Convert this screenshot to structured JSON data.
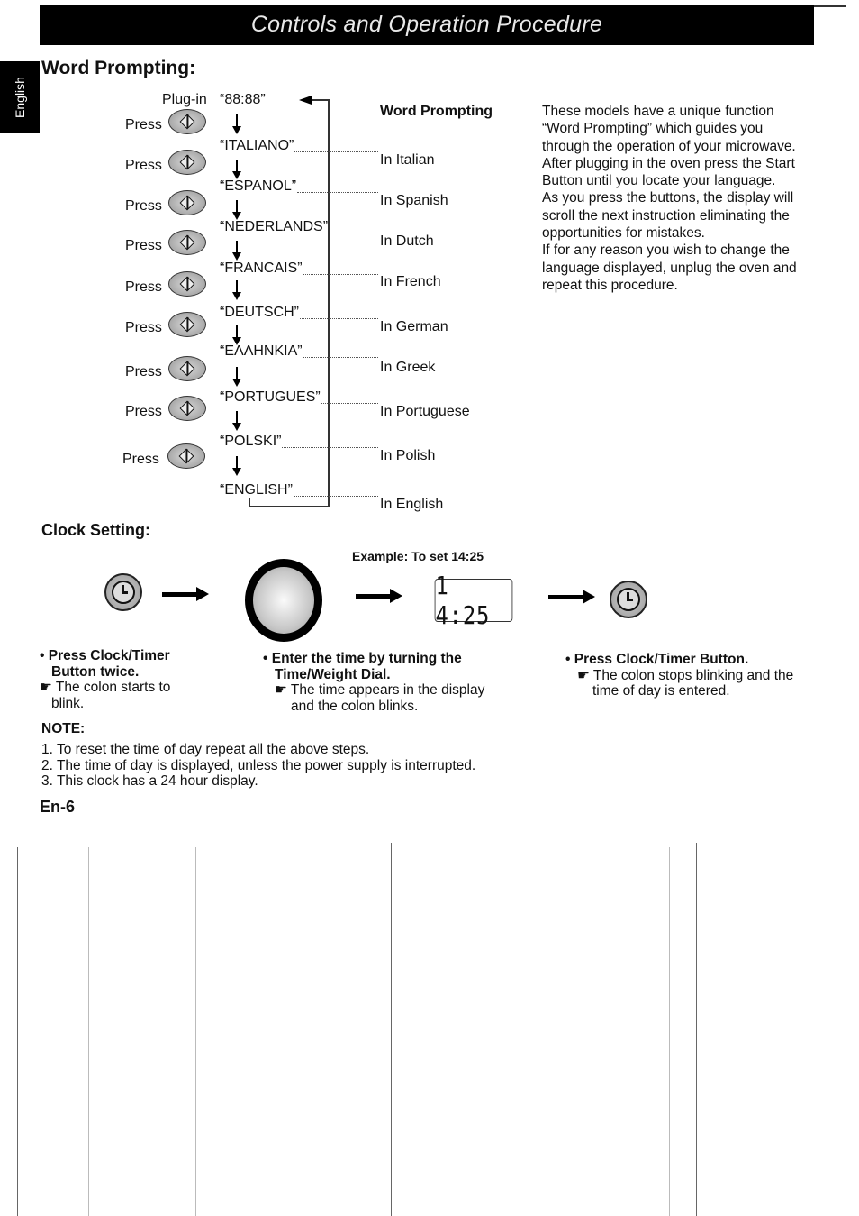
{
  "header": {
    "title": "Controls and Operation Procedure"
  },
  "side_tab": {
    "label": "English"
  },
  "word_prompting": {
    "heading": "Word Prompting:",
    "plug_in_label": "Plug-in",
    "initial_display": "“88:88”",
    "column_heading": "Word Prompting",
    "press_label": "Press",
    "button_icon": "start-button-diamond-icon",
    "steps": [
      {
        "display": "“ITALIANO”",
        "meaning": "In Italian"
      },
      {
        "display": "“ESPANOL”",
        "meaning": "In Spanish"
      },
      {
        "display": "“NEDERLANDS”",
        "meaning": "In Dutch"
      },
      {
        "display": "“FRANCAIS”",
        "meaning": "In French"
      },
      {
        "display": "“DEUTSCH”",
        "meaning": "In German"
      },
      {
        "display": "“ΕΛΛΗΝΚΙΑ”",
        "meaning": "In Greek"
      },
      {
        "display": "“PORTUGUES”",
        "meaning": "In Portuguese"
      },
      {
        "display": "“POLSKI”",
        "meaning": "In Polish"
      },
      {
        "display": "“ENGLISH”",
        "meaning": "In English"
      }
    ],
    "description": [
      "These models have a unique function",
      "“Word Prompting” which guides you",
      "through the operation of your microwave.",
      "After plugging in the oven press the Start",
      "Button until you locate your language.",
      "As you press the buttons, the display will",
      "scroll the next instruction eliminating the",
      "opportunities for mistakes.",
      "If for any reason you wish to change the",
      "language displayed, unplug the oven and",
      "repeat this procedure."
    ]
  },
  "clock_setting": {
    "heading": "Clock Setting:",
    "example_label": "Example: To set 14:25",
    "lcd_display": "1 4:25",
    "icons": [
      "clock-timer-button-icon",
      "arrow-right-icon",
      "time-weight-dial-icon",
      "arrow-right-icon",
      "lcd-display",
      "arrow-right-icon",
      "clock-timer-button-icon"
    ],
    "steps": [
      {
        "bold": [
          "• Press Clock/Timer",
          "Button twice."
        ],
        "note": [
          "☛ The colon starts to",
          "blink."
        ]
      },
      {
        "bold": [
          "• Enter the time by turning the",
          "Time/Weight Dial."
        ],
        "note": [
          "☛ The time appears in the display",
          "and the colon blinks."
        ]
      },
      {
        "bold": [
          "• Press Clock/Timer Button."
        ],
        "note": [
          "☛ The colon stops blinking and the",
          "time of day is entered."
        ]
      }
    ]
  },
  "note": {
    "heading": "NOTE:",
    "items": [
      "1. To reset the time of day repeat all the above steps.",
      "2. The time of day is displayed, unless the power supply is interrupted.",
      "3. This clock has a 24 hour display."
    ]
  },
  "page_number": "En-6"
}
